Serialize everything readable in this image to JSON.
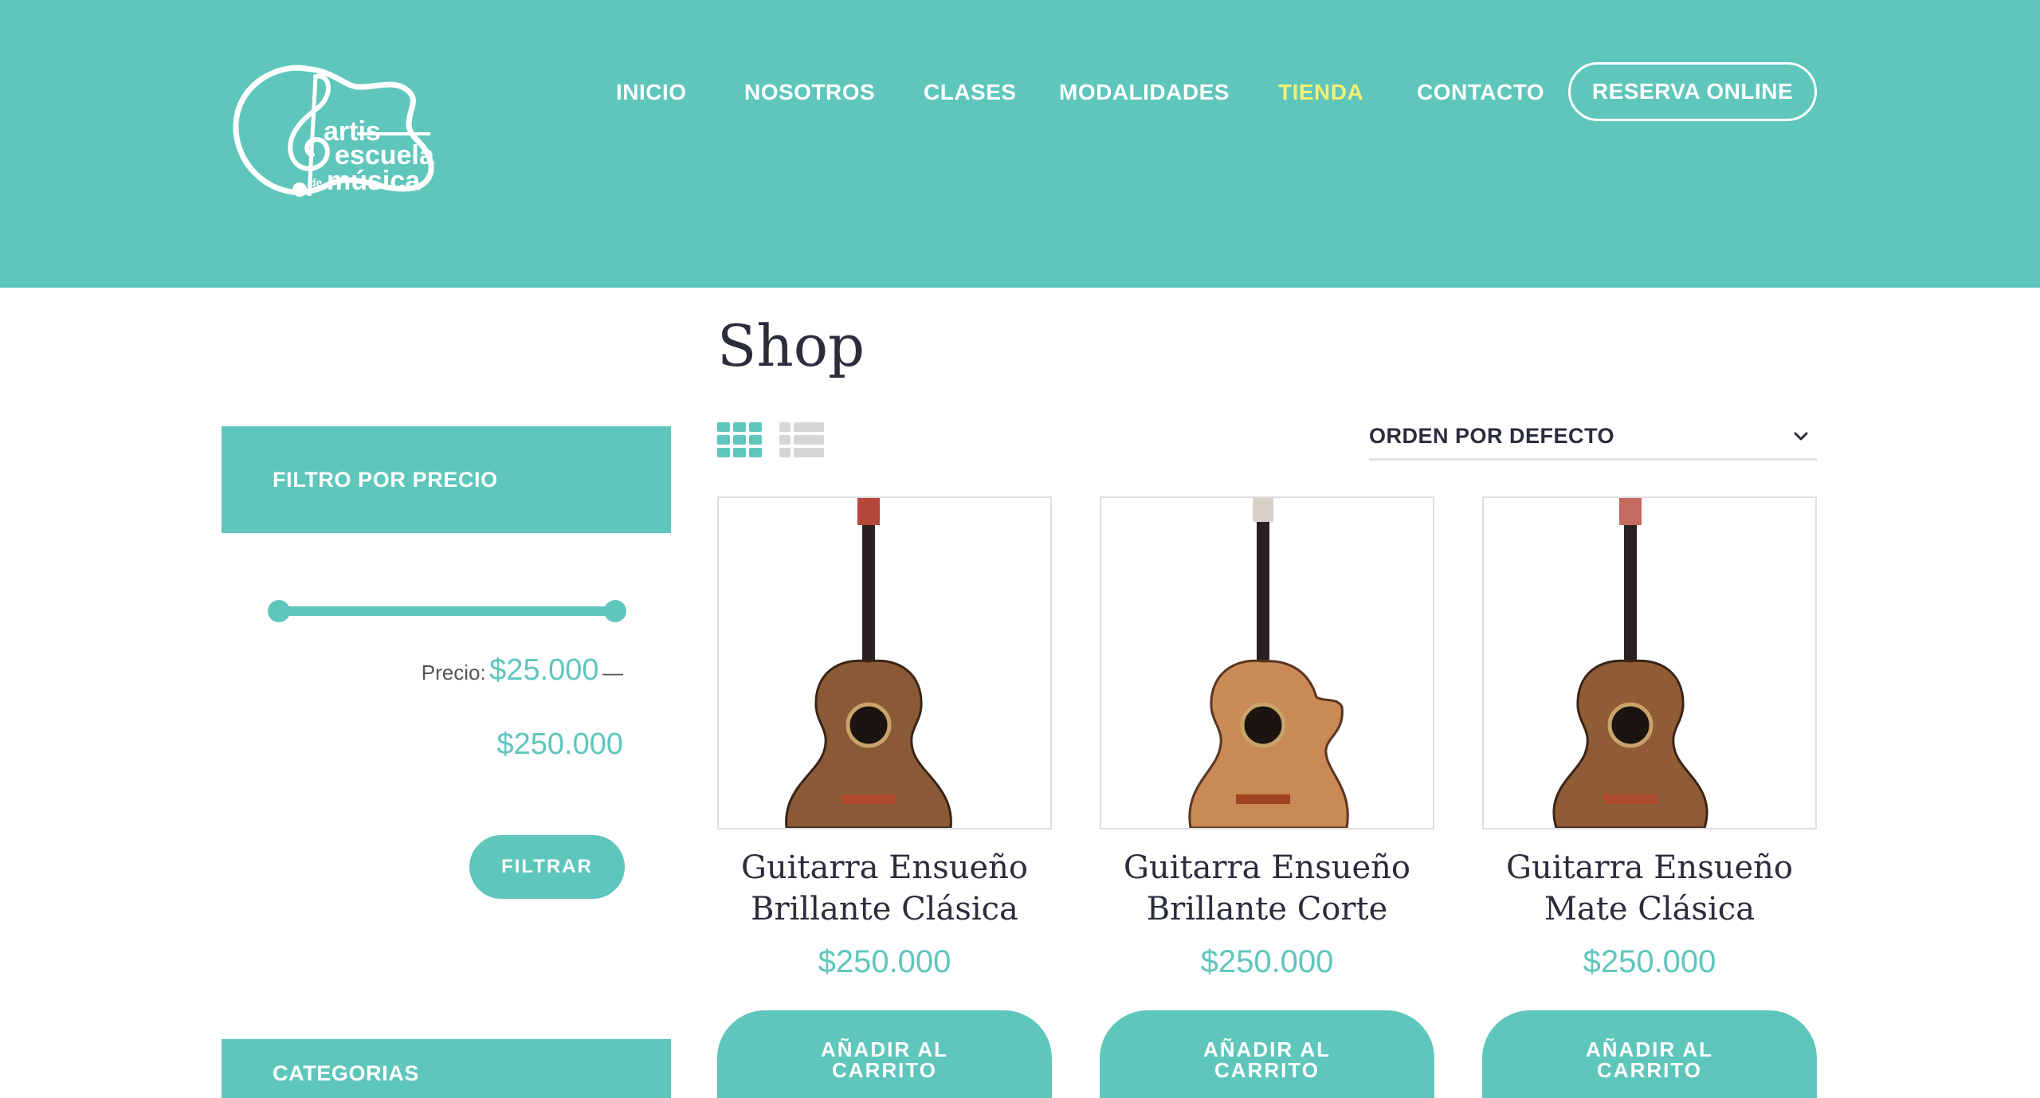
{
  "brand": {
    "logo_text_1": "artis",
    "logo_text_2": "escuela",
    "logo_text_3": "de",
    "logo_text_4": "música"
  },
  "nav": {
    "items": [
      {
        "label": "INICIO"
      },
      {
        "label": "NOSOTROS"
      },
      {
        "label": "CLASES"
      },
      {
        "label": "MODALIDADES"
      },
      {
        "label": "TIENDA"
      },
      {
        "label": "CONTACTO"
      }
    ],
    "cta": "RESERVA ONLINE",
    "active_color": "#f4f074"
  },
  "page": {
    "title": "Shop"
  },
  "sidebar": {
    "price_filter": {
      "heading": "FILTRO POR PRECIO",
      "label": "Precio:",
      "min": "$25.000",
      "dash": "—",
      "max": "$250.000",
      "button": "FILTRAR"
    },
    "categories": {
      "heading": "CATEGORIAS"
    }
  },
  "toolbar": {
    "sort_label": "ORDEN POR DEFECTO"
  },
  "products": [
    {
      "name_line1": "Guitarra Ensueño",
      "name_line2": "Brillante Clásica",
      "price": "$250.000",
      "button_line1": "AÑADIR AL",
      "button_line2": "CARRITO"
    },
    {
      "name_line1": "Guitarra Ensueño",
      "name_line2": "Brillante Corte",
      "price": "$250.000",
      "button_line1": "AÑADIR AL",
      "button_line2": "CARRITO"
    },
    {
      "name_line1": "Guitarra Ensueño",
      "name_line2": "Mate Clásica",
      "price": "$250.000",
      "button_line1": "AÑADIR AL",
      "button_line2": "CARRITO"
    }
  ],
  "colors": {
    "accent": "#5fc6bc",
    "dark_text": "#2a2d3c",
    "nav_active": "#f4f074"
  }
}
